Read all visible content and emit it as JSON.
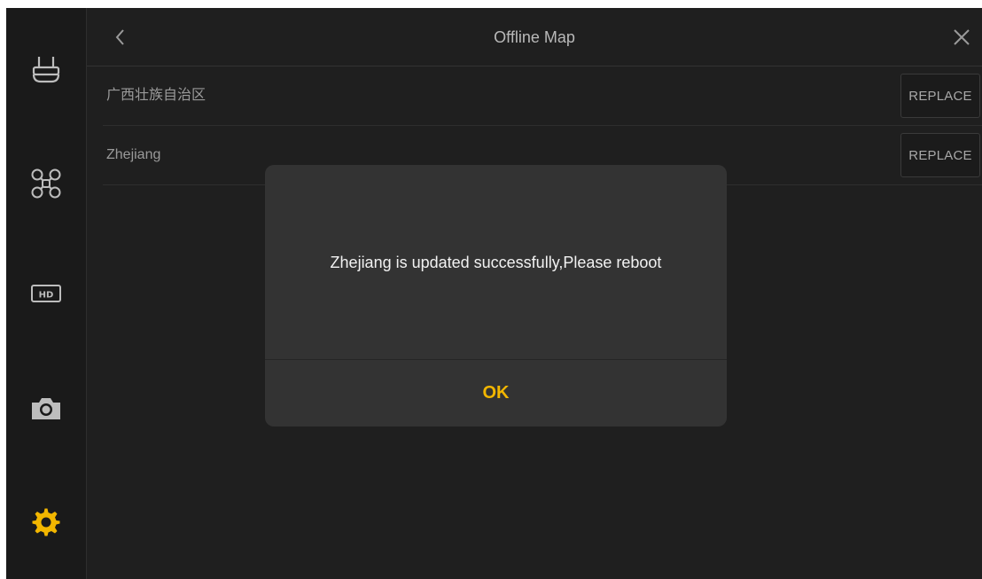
{
  "header": {
    "title": "Offline Map",
    "back_icon": "chevron-left-icon",
    "close_icon": "close-icon"
  },
  "sidebar": {
    "items": [
      {
        "name": "remote-controller",
        "icon": "remote-controller-icon",
        "active": false
      },
      {
        "name": "aircraft",
        "icon": "drone-icon",
        "active": false
      },
      {
        "name": "hd-transmission",
        "icon": "hd-icon",
        "active": false
      },
      {
        "name": "camera",
        "icon": "camera-icon",
        "active": false
      },
      {
        "name": "general-settings",
        "icon": "gear-icon",
        "active": true
      }
    ]
  },
  "maps": [
    {
      "name": "广西壮族自治区",
      "action": "REPLACE"
    },
    {
      "name": "Zhejiang",
      "action": "REPLACE"
    }
  ],
  "dialog": {
    "message": "Zhejiang is updated successfully,Please reboot",
    "ok_label": "OK"
  },
  "colors": {
    "accent": "#f2b600",
    "background": "#1f1f1f",
    "dialog_bg": "#333333"
  }
}
